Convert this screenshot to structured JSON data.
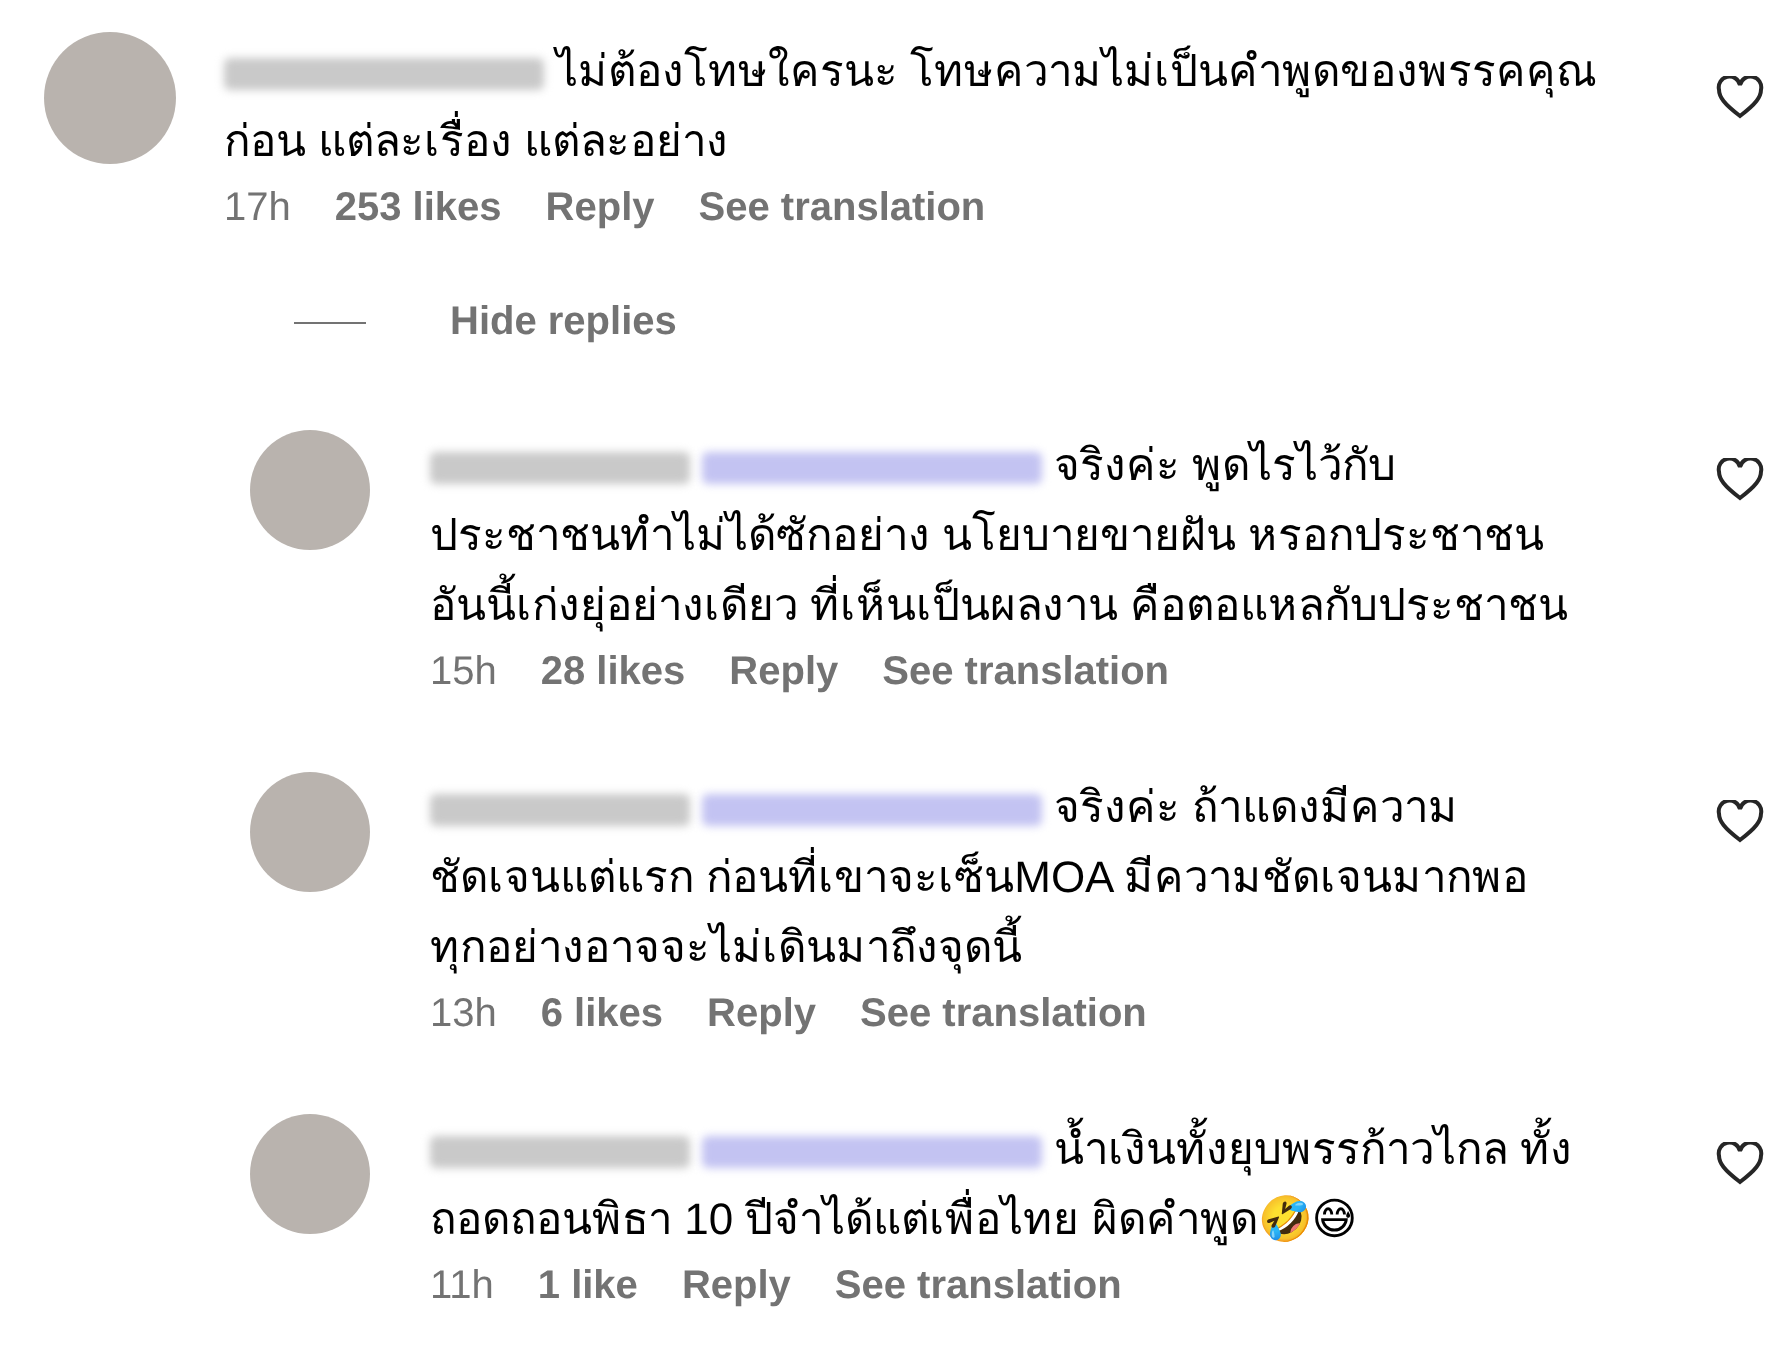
{
  "comment": {
    "kind": "comment",
    "text": "ไม่ต้องโทษใครนะ โทษความไม่เป็นคำพูดของพรรคคุณก่อน แต่ละเรื่อง แต่ละอย่าง",
    "time": "17h",
    "likes": "253 likes",
    "reply": "Reply",
    "translate": "See translation",
    "liked": false
  },
  "hide_replies": "Hide replies",
  "replies": [
    {
      "kind": "reply",
      "text": "จริงค่ะ พูดไรไว้กับประชาชนทำไม่ได้ซักอย่าง นโยบายขายฝัน หรอกประชาชน อันนี้เก่งยุ่อย่างเดียว ที่เห็นเป็นผลงาน คือตอแหลกับประชาชน",
      "time": "15h",
      "likes": "28 likes",
      "reply": "Reply",
      "translate": "See translation",
      "liked": false
    },
    {
      "kind": "reply",
      "text": "จริงค่ะ ถ้าแดงมีความชัดเจนแต่แรก ก่อนที่เขาจะเซ็นMOA มีความชัดเจนมากพอทุกอย่างอาจจะไม่เดินมาถึงจุดนี้",
      "time": "13h",
      "likes": "6 likes",
      "reply": "Reply",
      "translate": "See translation",
      "liked": false
    },
    {
      "kind": "reply",
      "text": "น้ำเงินทั้งยุบพรรก้าวไกล ทั้งถอดถอนพิธา 10 ปีจำได้แต่เพื่อไทย ผิดคำพูด🤣😅",
      "time": "11h",
      "likes": "1 like",
      "reply": "Reply",
      "translate": "See translation",
      "liked": false
    }
  ]
}
